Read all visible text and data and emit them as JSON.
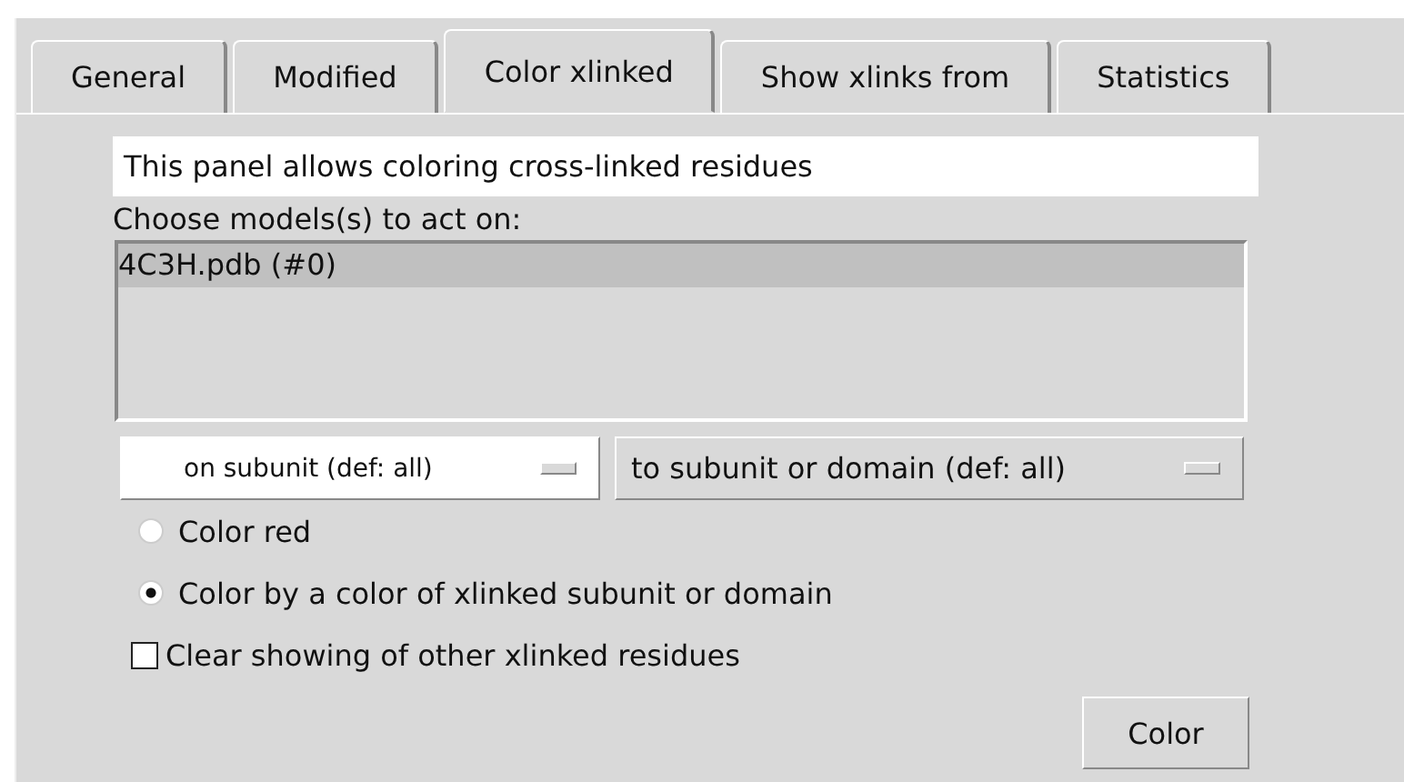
{
  "tabs": [
    {
      "label": "General",
      "selected": false
    },
    {
      "label": "Modified",
      "selected": false
    },
    {
      "label": "Color xlinked",
      "selected": true
    },
    {
      "label": "Show xlinks from",
      "selected": false
    },
    {
      "label": "Statistics",
      "selected": false
    }
  ],
  "info": "This panel allows coloring cross-linked residues",
  "models": {
    "label": "Choose models(s) to act on:",
    "items": [
      {
        "label": "4C3H.pdb (#0)",
        "selected": true
      }
    ]
  },
  "menus": [
    {
      "label": "on subunit (def: all)",
      "kind": "white"
    },
    {
      "label": "to subunit or domain (def: all)",
      "kind": "gray"
    }
  ],
  "options": [
    {
      "label": "Color red",
      "kind": "radio",
      "selected": false
    },
    {
      "label": "Color by a color of xlinked subunit or domain",
      "kind": "radio",
      "selected": true
    },
    {
      "label": "Clear showing of other xlinked residues",
      "kind": "checkbox",
      "checked": false
    }
  ],
  "button": "Color"
}
